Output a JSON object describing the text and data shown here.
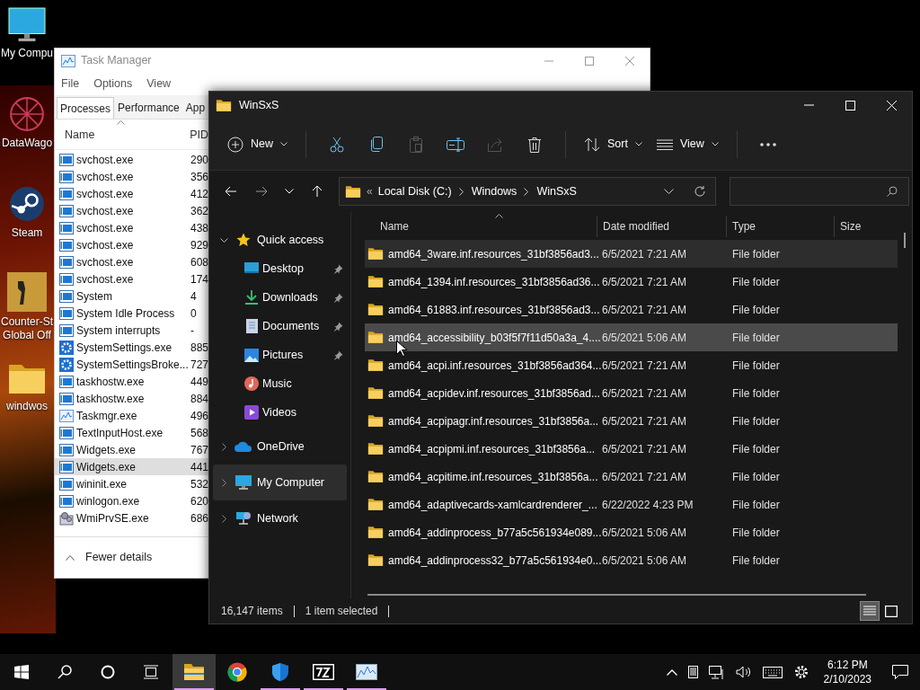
{
  "desktop": {
    "icons": [
      {
        "label": "My Compu",
        "kind": "computer"
      },
      {
        "label": "DataWago",
        "kind": "web"
      },
      {
        "label": "Steam",
        "kind": "steam"
      },
      {
        "label": "Counter-St\nGlobal Off",
        "kind": "game"
      },
      {
        "label": "windwos",
        "kind": "folder"
      }
    ]
  },
  "task_manager": {
    "title": "Task Manager",
    "menu": [
      "File",
      "Options",
      "View"
    ],
    "tabs": [
      {
        "label": "Processes",
        "selected": true
      },
      {
        "label": "Performance",
        "selected": false
      },
      {
        "label": "App",
        "selected": false
      }
    ],
    "columns": [
      "Name",
      "PID"
    ],
    "processes": [
      {
        "name": "svchost.exe",
        "pid": "290",
        "kind": "service",
        "selected": false
      },
      {
        "name": "svchost.exe",
        "pid": "356",
        "kind": "service",
        "selected": false
      },
      {
        "name": "svchost.exe",
        "pid": "412",
        "kind": "service",
        "selected": false
      },
      {
        "name": "svchost.exe",
        "pid": "362",
        "kind": "service",
        "selected": false
      },
      {
        "name": "svchost.exe",
        "pid": "438",
        "kind": "service",
        "selected": false
      },
      {
        "name": "svchost.exe",
        "pid": "929",
        "kind": "service",
        "selected": false
      },
      {
        "name": "svchost.exe",
        "pid": "608",
        "kind": "service",
        "selected": false
      },
      {
        "name": "svchost.exe",
        "pid": "174",
        "kind": "service",
        "selected": false
      },
      {
        "name": "System",
        "pid": "4",
        "kind": "service",
        "selected": false
      },
      {
        "name": "System Idle Process",
        "pid": "0",
        "kind": "service",
        "selected": false
      },
      {
        "name": "System interrupts",
        "pid": "-",
        "kind": "service",
        "selected": false
      },
      {
        "name": "SystemSettings.exe",
        "pid": "885",
        "kind": "settings",
        "selected": false
      },
      {
        "name": "SystemSettingsBroke...",
        "pid": "727",
        "kind": "settings",
        "selected": false
      },
      {
        "name": "taskhostw.exe",
        "pid": "449",
        "kind": "service",
        "selected": false
      },
      {
        "name": "taskhostw.exe",
        "pid": "884",
        "kind": "service",
        "selected": false
      },
      {
        "name": "Taskmgr.exe",
        "pid": "496",
        "kind": "monitor",
        "selected": false
      },
      {
        "name": "TextInputHost.exe",
        "pid": "568",
        "kind": "service",
        "selected": false
      },
      {
        "name": "Widgets.exe",
        "pid": "767",
        "kind": "service",
        "selected": false
      },
      {
        "name": "Widgets.exe",
        "pid": "441",
        "kind": "service",
        "selected": true
      },
      {
        "name": "wininit.exe",
        "pid": "532",
        "kind": "service",
        "selected": false
      },
      {
        "name": "winlogon.exe",
        "pid": "620",
        "kind": "service",
        "selected": false
      },
      {
        "name": "WmiPrvSE.exe",
        "pid": "686",
        "kind": "wmi",
        "selected": false
      }
    ],
    "footer": "Fewer details"
  },
  "explorer": {
    "title": "WinSxS",
    "toolbar": [
      {
        "kind": "new",
        "label": "New",
        "disabled": false
      },
      {
        "kind": "cut",
        "disabled": false
      },
      {
        "kind": "copy",
        "disabled": false
      },
      {
        "kind": "paste",
        "disabled": true
      },
      {
        "kind": "rename",
        "disabled": false
      },
      {
        "kind": "share",
        "disabled": true
      },
      {
        "kind": "delete",
        "disabled": false
      },
      {
        "kind": "sort",
        "label": "Sort",
        "disabled": false
      },
      {
        "kind": "view",
        "label": "View",
        "disabled": false
      },
      {
        "kind": "more",
        "disabled": false
      }
    ],
    "breadcrumb_overflow": "«",
    "breadcrumb": [
      "Local Disk (C:)",
      "Windows",
      "WinSxS"
    ],
    "nav": [
      {
        "label": "Quick access",
        "kind": "star",
        "expanded": true,
        "selected": false,
        "children": [
          {
            "label": "Desktop",
            "kind": "desktop",
            "pinned": true,
            "selected": false
          },
          {
            "label": "Downloads",
            "kind": "download",
            "pinned": true,
            "selected": false
          },
          {
            "label": "Documents",
            "kind": "document",
            "pinned": true,
            "selected": false
          },
          {
            "label": "Pictures",
            "kind": "picture",
            "pinned": true,
            "selected": false
          },
          {
            "label": "Music",
            "kind": "music",
            "pinned": false,
            "selected": false
          },
          {
            "label": "Videos",
            "kind": "video",
            "pinned": false,
            "selected": false
          }
        ]
      },
      {
        "label": "OneDrive",
        "kind": "cloud",
        "expanded": false,
        "selected": false
      },
      {
        "label": "My Computer",
        "kind": "computer",
        "expanded": false,
        "selected": true
      },
      {
        "label": "Network",
        "kind": "network",
        "expanded": false,
        "selected": false
      }
    ],
    "columns": [
      "Name",
      "Date modified",
      "Type",
      "Size"
    ],
    "rows": [
      {
        "name": "amd64_3ware.inf.resources_31bf3856ad3...",
        "date": "6/5/2021 7:21 AM",
        "type": "File folder",
        "hovered": true,
        "selected": false
      },
      {
        "name": "amd64_1394.inf.resources_31bf3856ad36...",
        "date": "6/5/2021 7:21 AM",
        "type": "File folder",
        "hovered": false,
        "selected": false
      },
      {
        "name": "amd64_61883.inf.resources_31bf3856ad3...",
        "date": "6/5/2021 7:21 AM",
        "type": "File folder",
        "hovered": false,
        "selected": false
      },
      {
        "name": "amd64_accessibility_b03f5f7f11d50a3a_4....",
        "date": "6/5/2021 5:06 AM",
        "type": "File folder",
        "hovered": false,
        "selected": true
      },
      {
        "name": "amd64_acpi.inf.resources_31bf3856ad364...",
        "date": "6/5/2021 7:21 AM",
        "type": "File folder",
        "hovered": false,
        "selected": false
      },
      {
        "name": "amd64_acpidev.inf.resources_31bf3856ad...",
        "date": "6/5/2021 7:21 AM",
        "type": "File folder",
        "hovered": false,
        "selected": false
      },
      {
        "name": "amd64_acpipagr.inf.resources_31bf3856a...",
        "date": "6/5/2021 7:21 AM",
        "type": "File folder",
        "hovered": false,
        "selected": false
      },
      {
        "name": "amd64_acpipmi.inf.resources_31bf3856a...",
        "date": "6/5/2021 7:21 AM",
        "type": "File folder",
        "hovered": false,
        "selected": false
      },
      {
        "name": "amd64_acpitime.inf.resources_31bf3856a...",
        "date": "6/5/2021 7:21 AM",
        "type": "File folder",
        "hovered": false,
        "selected": false
      },
      {
        "name": "amd64_adaptivecards-xamlcardrenderer_...",
        "date": "6/22/2022 4:23 PM",
        "type": "File folder",
        "hovered": false,
        "selected": false
      },
      {
        "name": "amd64_addinprocess_b77a5c561934e089...",
        "date": "6/5/2021 5:06 AM",
        "type": "File folder",
        "hovered": false,
        "selected": false
      },
      {
        "name": "amd64_addinprocess32_b77a5c561934e0...",
        "date": "6/5/2021 5:06 AM",
        "type": "File folder",
        "hovered": false,
        "selected": false
      }
    ],
    "status": [
      "16,147 items",
      "1 item selected"
    ],
    "view_modes": [
      {
        "kind": "details",
        "selected": true
      },
      {
        "kind": "tiles",
        "selected": false
      }
    ]
  },
  "taskbar": {
    "apps": [
      {
        "kind": "explorer",
        "running": true,
        "active": true
      },
      {
        "kind": "chrome",
        "running": false,
        "active": false
      },
      {
        "kind": "defender",
        "running": true,
        "active": false
      },
      {
        "kind": "archiver",
        "running": true,
        "active": false
      },
      {
        "kind": "monitor",
        "running": true,
        "active": false
      }
    ],
    "time": "6:12 PM",
    "date": "2/10/2023"
  }
}
